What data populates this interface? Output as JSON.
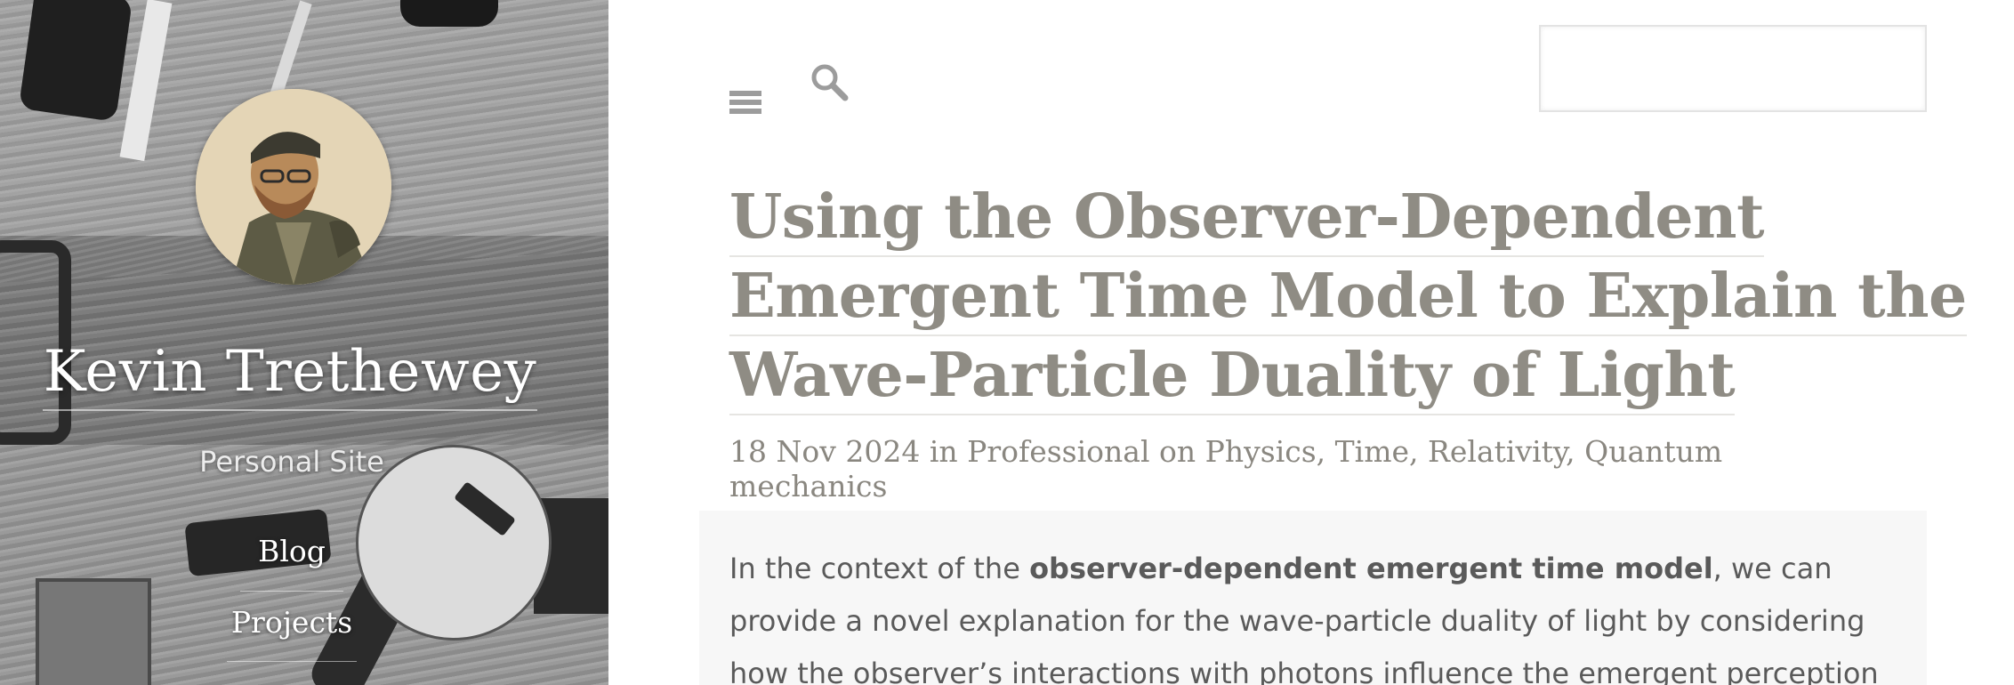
{
  "sidebar": {
    "site_title": "Kevin Trethewey",
    "site_subtitle": "Personal Site",
    "nav": [
      {
        "label": "Blog"
      },
      {
        "label": "Projects"
      }
    ]
  },
  "header": {
    "menu_icon": "hamburger-menu-icon",
    "search_icon": "magnifier-icon",
    "search_placeholder": ""
  },
  "post": {
    "title_lines": [
      "Using the Observer-Dependent",
      "Emergent Time Model to Explain the",
      "Wave-Particle Duality of Light"
    ],
    "date": "18 Nov 2024",
    "in_word": "in",
    "category": "Professional",
    "on_word": "on",
    "tags": [
      "Physics",
      "Time",
      "Relativity",
      "Quantum mechanics"
    ],
    "body": {
      "line1_pre": "In the context of the ",
      "line1_bold": "observer-dependent emergent time model",
      "line1_post": ", we can",
      "line2": "provide a novel explanation for the wave-particle duality of light by considering",
      "line3": "how the observer’s interactions with photons influence the emergent perception"
    }
  },
  "colors": {
    "title": "#8f8c84",
    "meta": "#8a8780",
    "body_text": "#5a5a5a",
    "content_bg": "#f7f7f7",
    "sidebar_text": "#ffffff"
  }
}
